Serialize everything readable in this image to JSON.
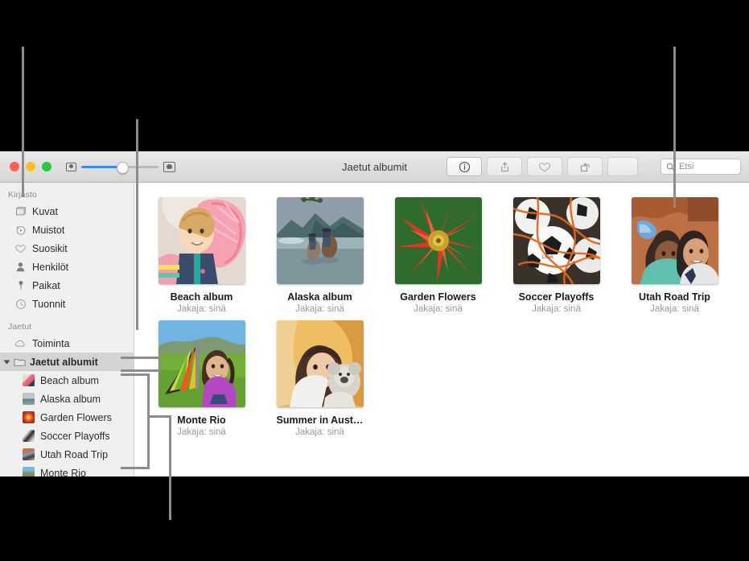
{
  "window": {
    "title": "Jaetut albumit",
    "traffic_lights": [
      "close",
      "minimize",
      "zoom"
    ],
    "toolbar": {
      "info_label": "info-button",
      "share_label": "share-button",
      "favorite_label": "favorite-button",
      "rotate_label": "rotate-button",
      "search_placeholder": "Etsi"
    }
  },
  "sidebar": {
    "library_header": "Kirjasto",
    "library_items": [
      {
        "label": "Kuvat",
        "icon": "photos-icon"
      },
      {
        "label": "Muistot",
        "icon": "memories-icon"
      },
      {
        "label": "Suosikit",
        "icon": "heart-icon"
      },
      {
        "label": "Henkilöt",
        "icon": "person-icon"
      },
      {
        "label": "Paikat",
        "icon": "pin-icon"
      },
      {
        "label": "Tuonnit",
        "icon": "clock-icon"
      }
    ],
    "shared_header": "Jaetut",
    "activity": {
      "label": "Toiminta",
      "icon": "cloud-icon"
    },
    "shared_albums_group": {
      "label": "Jaetut albumit",
      "icon": "folder-icon",
      "selected": true
    },
    "shared_albums": [
      {
        "label": "Beach album"
      },
      {
        "label": "Alaska album"
      },
      {
        "label": "Garden Flowers"
      },
      {
        "label": "Soccer Playoffs"
      },
      {
        "label": "Utah Road Trip"
      },
      {
        "label": "Monte Rio"
      }
    ]
  },
  "main": {
    "albums": [
      {
        "name": "Beach album",
        "subtitle": "Jakaja: sinä"
      },
      {
        "name": "Alaska album",
        "subtitle": "Jakaja: sinä"
      },
      {
        "name": "Garden Flowers",
        "subtitle": "Jakaja: sinä"
      },
      {
        "name": "Soccer Playoffs",
        "subtitle": "Jakaja: sinä"
      },
      {
        "name": "Utah Road Trip",
        "subtitle": "Jakaja: sinä"
      },
      {
        "name": "Monte Rio",
        "subtitle": "Jakaja: sinä"
      },
      {
        "name": "Summer in Aust…",
        "subtitle": "Jakaja: sinä"
      }
    ]
  },
  "colors": {
    "accent": "#3b8cf0",
    "selection": "#d4d4d4",
    "sidebar_bg": "#f0f0f0",
    "callout_line": "#8c8c8c",
    "backdrop": "#000000"
  }
}
